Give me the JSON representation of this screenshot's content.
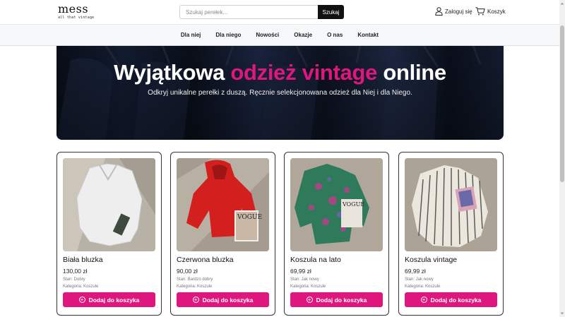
{
  "header": {
    "logo_main": "mess",
    "logo_tagline": "all that vintage",
    "search_placeholder": "Szukaj perełek...",
    "search_button": "Szukaj",
    "login_label": "Zaloguj się",
    "cart_label": "Koszyk"
  },
  "nav": {
    "items": [
      "Dla niej",
      "Dla niego",
      "Nowości",
      "Okazje",
      "O nas",
      "Kontakt"
    ]
  },
  "hero": {
    "title_part1": "Wyjątkowa ",
    "title_accent": "odzież vintage",
    "title_part2": " online",
    "subtitle": "Odkryj unikalne perełki z duszą. Ręcznie selekcjonowana odzież dla Niej i dla Niego."
  },
  "products": [
    {
      "name": "Biała bluzka",
      "price": "130,00 zł",
      "condition": "Stan: Dobry",
      "category": "Kategoria: Koszule",
      "button": "Dodaj do koszyka"
    },
    {
      "name": "Czerwona bluzka",
      "price": "90,00 zł",
      "condition": "Stan: Bardzo dobry",
      "category": "Kategoria: Koszule",
      "button": "Dodaj do koszyka"
    },
    {
      "name": "Koszula na lato",
      "price": "69,99 zł",
      "condition": "Stan: Jak nowy",
      "category": "Kategoria: Koszule",
      "button": "Dodaj do koszyka"
    },
    {
      "name": "Koszula vintage",
      "price": "69,99 zł",
      "condition": "Stan: Jak nowy",
      "category": "Kategoria: Koszule",
      "button": "Dodaj do koszyka"
    }
  ],
  "colors": {
    "accent": "#e0167f",
    "button_dark": "#111111",
    "nav_bg": "#f7f8f9"
  }
}
